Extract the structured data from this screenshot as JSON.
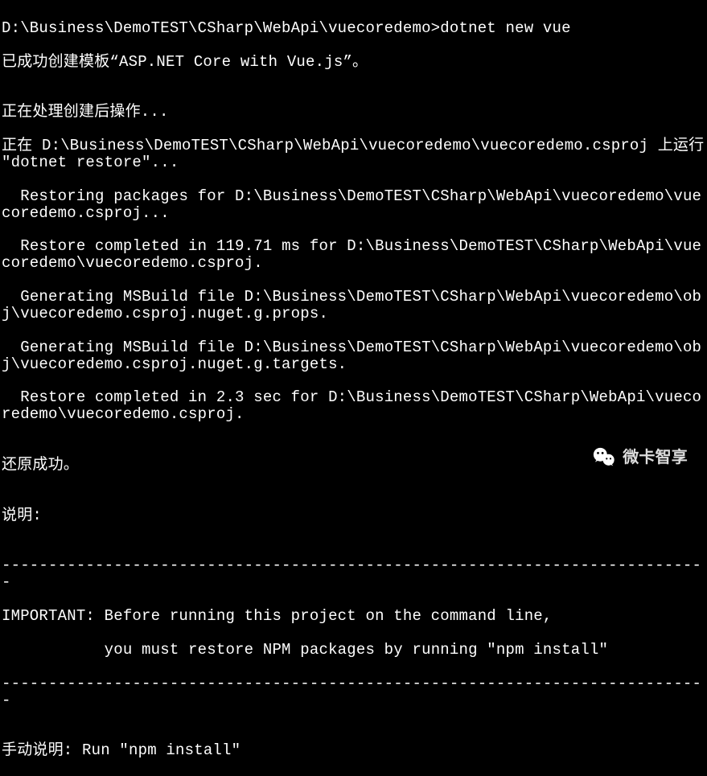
{
  "terminal": {
    "lines": [
      "D:\\Business\\DemoTEST\\CSharp\\WebApi\\vuecoredemo>dotnet new vue",
      "已成功创建模板“ASP.NET Core with Vue.js”。",
      "",
      "正在处理创建后操作...",
      "正在 D:\\Business\\DemoTEST\\CSharp\\WebApi\\vuecoredemo\\vuecoredemo.csproj 上运行 \"dotnet restore\"...",
      "  Restoring packages for D:\\Business\\DemoTEST\\CSharp\\WebApi\\vuecoredemo\\vuecoredemo.csproj...",
      "  Restore completed in 119.71 ms for D:\\Business\\DemoTEST\\CSharp\\WebApi\\vuecoredemo\\vuecoredemo.csproj.",
      "  Generating MSBuild file D:\\Business\\DemoTEST\\CSharp\\WebApi\\vuecoredemo\\obj\\vuecoredemo.csproj.nuget.g.props.",
      "  Generating MSBuild file D:\\Business\\DemoTEST\\CSharp\\WebApi\\vuecoredemo\\obj\\vuecoredemo.csproj.nuget.g.targets.",
      "  Restore completed in 2.3 sec for D:\\Business\\DemoTEST\\CSharp\\WebApi\\vuecoredemo\\vuecoredemo.csproj.",
      "",
      "还原成功。",
      "",
      "说明:",
      "",
      "----------------------------------------------------------------------------",
      "IMPORTANT: Before running this project on the command line,",
      "           you must restore NPM packages by running \"npm install\"",
      "----------------------------------------------------------------------------",
      "",
      "手动说明: Run \"npm install\""
    ]
  },
  "watermark": {
    "text": "微卡智享"
  }
}
